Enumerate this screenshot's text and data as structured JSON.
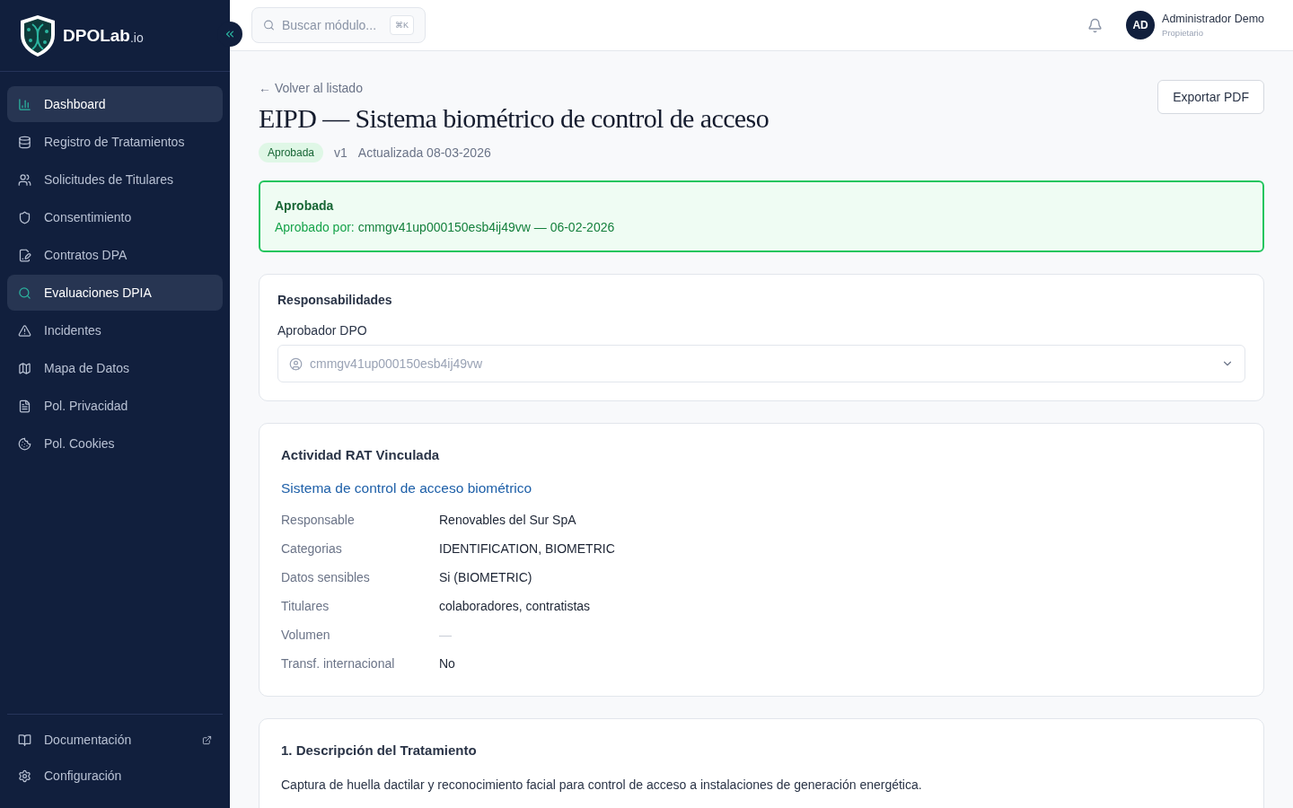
{
  "brand": {
    "name": "DPOLab",
    "suffix": ".io"
  },
  "sidebar": {
    "items": [
      {
        "label": "Dashboard",
        "selected": true
      },
      {
        "label": "Registro de Tratamientos",
        "selected": false
      },
      {
        "label": "Solicitudes de Titulares",
        "selected": false
      },
      {
        "label": "Consentimiento",
        "selected": false
      },
      {
        "label": "Contratos DPA",
        "selected": false
      },
      {
        "label": "Evaluaciones DPIA",
        "selected": true
      },
      {
        "label": "Incidentes",
        "selected": false
      },
      {
        "label": "Mapa de Datos",
        "selected": false
      },
      {
        "label": "Pol. Privacidad",
        "selected": false
      },
      {
        "label": "Pol. Cookies",
        "selected": false
      }
    ],
    "footer": [
      {
        "label": "Documentación",
        "external": true
      },
      {
        "label": "Configuración",
        "external": false
      }
    ]
  },
  "topbar": {
    "search": {
      "placeholder": "Buscar módulo...",
      "shortcut": "⌘K"
    },
    "user": {
      "initials": "AD",
      "name": "Administrador Demo",
      "role": "Propietario"
    }
  },
  "page": {
    "back": "← Volver al listado",
    "title": "EIPD — Sistema biométrico de control de acceso",
    "export": "Exportar PDF",
    "status": "Aprobada",
    "version": "v1",
    "updated": "Actualizada 08-03-2026"
  },
  "approval": {
    "title": "Aprobada",
    "text": "Aprobado por: **cmmgv41up000150esb4ij49vw — 06-02-2026**"
  },
  "responsibilities": {
    "title": "Responsabilidades",
    "label": "Aprobador DPO",
    "value": "cmmgv41up000150esb4ij49vw"
  },
  "rat": {
    "title": "Actividad RAT Vinculada",
    "link": "Sistema de control de acceso biométrico",
    "rows": [
      {
        "label": "Responsable",
        "value": "Renovables del Sur SpA",
        "empty": false
      },
      {
        "label": "Categorias",
        "value": "IDENTIFICATION, BIOMETRIC",
        "empty": false
      },
      {
        "label": "Datos sensibles",
        "value": "Si (BIOMETRIC)",
        "empty": false
      },
      {
        "label": "Titulares",
        "value": "colaboradores, contratistas",
        "empty": false
      },
      {
        "label": "Volumen",
        "value": "—",
        "empty": true
      },
      {
        "label": "Transf. internacional",
        "value": "No",
        "empty": false
      }
    ]
  },
  "description": {
    "title": "1. Descripción del Tratamiento",
    "text": "Captura de huella dactilar y reconocimiento facial para control de acceso a instalaciones de generación energética."
  }
}
